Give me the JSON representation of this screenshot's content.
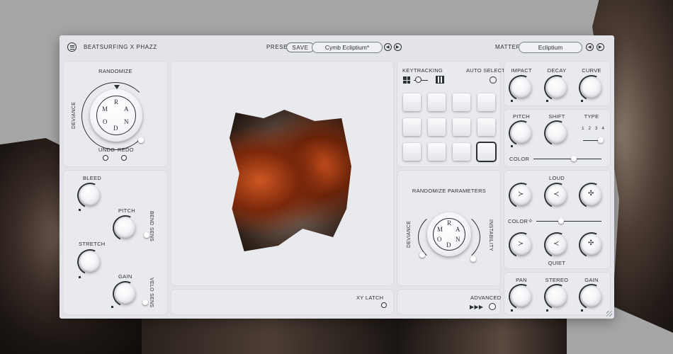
{
  "header": {
    "brand": "BEATSURFING X PHAZZ",
    "preset_label": "PRESET",
    "save_label": "SAVE",
    "preset_name": "Cymb Ecliptium*",
    "matter_label": "MATTER",
    "matter_name": "Ecliptium"
  },
  "randomize": {
    "title": "RANDOMIZE",
    "deviance": "DEVIANCE",
    "letters": [
      "R",
      "A",
      "N",
      "D",
      "O",
      "M"
    ],
    "undo": "UNDO",
    "redo": "REDO"
  },
  "modulation": {
    "bleed": "BLEED",
    "pitch": "PITCH",
    "bend_sens": "BEND SENS",
    "stretch": "STRETCH",
    "gain": "GAIN",
    "velo_sens": "VELO SENS"
  },
  "xy": {
    "latch": "XY LATCH"
  },
  "keytracking": {
    "title": "KEYTRACKING",
    "auto_select": "AUTO SELECT"
  },
  "randomize_params": {
    "title": "RANDOMIZE PARAMETERS",
    "deviance": "DEVIANCE",
    "instability": "INSTABILITY",
    "letters": [
      "R",
      "A",
      "N",
      "D",
      "O",
      "M"
    ]
  },
  "advanced": {
    "label": "ADVANCED",
    "arrows": "▶▶▶"
  },
  "envelope": {
    "impact": "IMPACT",
    "decay": "DECAY",
    "curve": "CURVE"
  },
  "tone": {
    "pitch": "PITCH",
    "shift": "SHIFT",
    "type": "TYPE",
    "type_options": [
      "1",
      "2",
      "3",
      "4"
    ],
    "color": "COLOR"
  },
  "dynamics": {
    "loud": "LOUD",
    "color": "COLOR",
    "quiet": "QUIET"
  },
  "output": {
    "pan": "PAN",
    "stereo": "STEREO",
    "gain": "GAIN"
  },
  "colors": {
    "panel": "#e9eaee",
    "frame": "#e3e4e9",
    "ink": "#2d2f36",
    "matter_copper": "#c65a2a"
  }
}
